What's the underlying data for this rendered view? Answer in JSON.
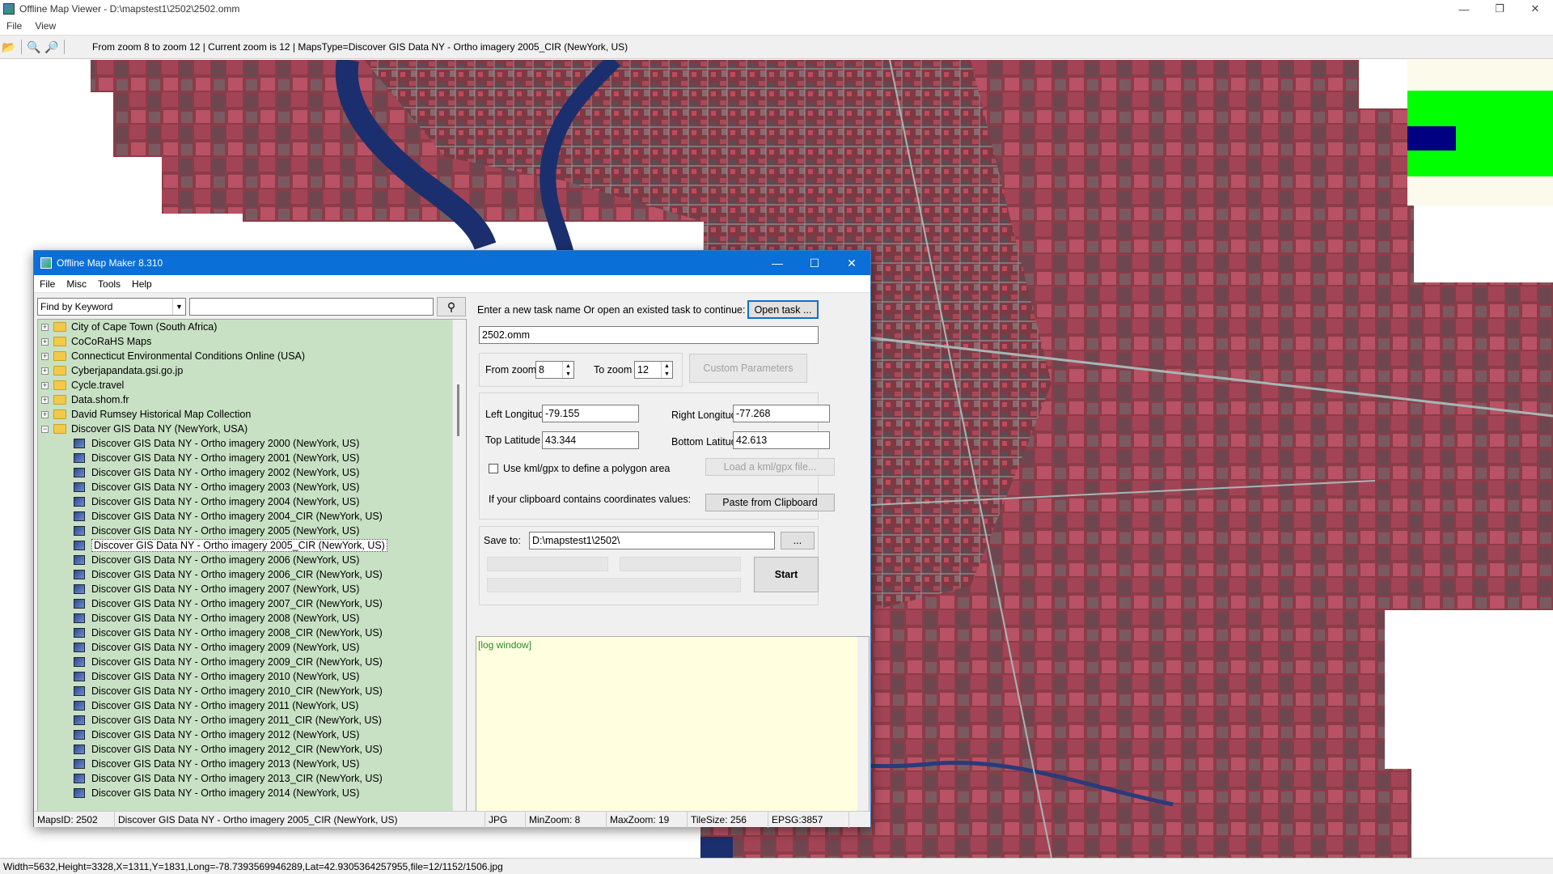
{
  "viewer": {
    "title": "Offline Map Viewer - D:\\mapstest1\\2502\\2502.omm",
    "menu": [
      "File",
      "View"
    ],
    "toolbar_status": "From zoom 8 to zoom 12    |   Current zoom is 12  |   MapsType=Discover GIS Data NY - Ortho imagery 2005_CIR (NewYork, US)",
    "statusbar": "Width=5632,Height=3328,X=1311,Y=1831,Long=-78.7393569946289,Lat=42.9305364257955,file=12/1152/1506.jpg"
  },
  "dialog": {
    "title": "Offline Map Maker 8.310",
    "menu": [
      "File",
      "Misc",
      "Tools",
      "Help"
    ],
    "keyword_select": "Find by Keyword",
    "search_value": "",
    "tree_parents": [
      "City of Cape Town (South Africa)",
      "CoCoRaHS Maps",
      "Connecticut Environmental Conditions Online (USA)",
      "Cyberjapandata.gsi.go.jp",
      "Cycle.travel",
      "Data.shom.fr",
      "David Rumsey Historical Map Collection",
      "Discover GIS Data NY (NewYork, USA)"
    ],
    "tree_children": [
      "Discover GIS Data NY - Ortho imagery 2000 (NewYork, US)",
      "Discover GIS Data NY - Ortho imagery 2001 (NewYork, US)",
      "Discover GIS Data NY - Ortho imagery 2002 (NewYork, US)",
      "Discover GIS Data NY - Ortho imagery 2003 (NewYork, US)",
      "Discover GIS Data NY - Ortho imagery 2004 (NewYork, US)",
      "Discover GIS Data NY - Ortho imagery 2004_CIR (NewYork, US)",
      "Discover GIS Data NY - Ortho imagery 2005 (NewYork, US)",
      "Discover GIS Data NY - Ortho imagery 2005_CIR (NewYork, US)",
      "Discover GIS Data NY - Ortho imagery 2006 (NewYork, US)",
      "Discover GIS Data NY - Ortho imagery 2006_CIR (NewYork, US)",
      "Discover GIS Data NY - Ortho imagery 2007 (NewYork, US)",
      "Discover GIS Data NY - Ortho imagery 2007_CIR (NewYork, US)",
      "Discover GIS Data NY - Ortho imagery 2008 (NewYork, US)",
      "Discover GIS Data NY - Ortho imagery 2008_CIR (NewYork, US)",
      "Discover GIS Data NY - Ortho imagery 2009 (NewYork, US)",
      "Discover GIS Data NY - Ortho imagery 2009_CIR (NewYork, US)",
      "Discover GIS Data NY - Ortho imagery 2010 (NewYork, US)",
      "Discover GIS Data NY - Ortho imagery 2010_CIR (NewYork, US)",
      "Discover GIS Data NY - Ortho imagery 2011 (NewYork, US)",
      "Discover GIS Data NY - Ortho imagery 2011_CIR (NewYork, US)",
      "Discover GIS Data NY - Ortho imagery 2012 (NewYork, US)",
      "Discover GIS Data NY - Ortho imagery 2012_CIR (NewYork, US)",
      "Discover GIS Data NY - Ortho imagery 2013 (NewYork, US)",
      "Discover GIS Data NY - Ortho imagery 2013_CIR (NewYork, US)",
      "Discover GIS Data NY - Ortho imagery 2014 (NewYork, US)"
    ],
    "selected_child": "Discover GIS Data NY - Ortho imagery 2005_CIR (NewYork, US)",
    "task_prompt": "Enter a new task name Or open an existed task to continue:",
    "open_task_label": "Open task ...",
    "task_name": "2502.omm",
    "from_zoom_label": "From zoom",
    "from_zoom": "8",
    "to_zoom_label": "To zoom",
    "to_zoom": "12",
    "custom_params_label": "Custom Parameters",
    "left_lon_label": "Left Longitude",
    "left_lon": "-79.155",
    "right_lon_label": "Right Longitude",
    "right_lon": "-77.268",
    "top_lat_label": "Top Latitude",
    "top_lat": "43.344",
    "bottom_lat_label": "Bottom Latitude",
    "bottom_lat": "42.613",
    "kml_label": "Use kml/gpx to define a polygon area",
    "load_kml_label": "Load a kml/gpx file...",
    "clipboard_prompt": "If your clipboard contains coordinates values:",
    "paste_label": "Paste from Clipboard",
    "save_to_label": "Save to:",
    "save_to": "D:\\mapstest1\\2502\\",
    "browse_label": "...",
    "start_label": "Start",
    "log_text": "[log window]",
    "status": {
      "maps_id": "MapsID: 2502",
      "map_name": "Discover GIS Data NY - Ortho imagery 2005_CIR (NewYork, US)",
      "format": "JPG",
      "min_zoom": "MinZoom: 8",
      "max_zoom": "MaxZoom: 19",
      "tile_size": "TileSize: 256",
      "epsg": "EPSG:3857"
    }
  },
  "colors": {
    "dialog_title_bg": "#0a6fd6",
    "tree_bg": "#c8e1c4",
    "log_bg": "#ffffe0",
    "map_red": "#8a3a44",
    "river_blue": "#1b2f6e",
    "green_block": "#00ff00"
  }
}
